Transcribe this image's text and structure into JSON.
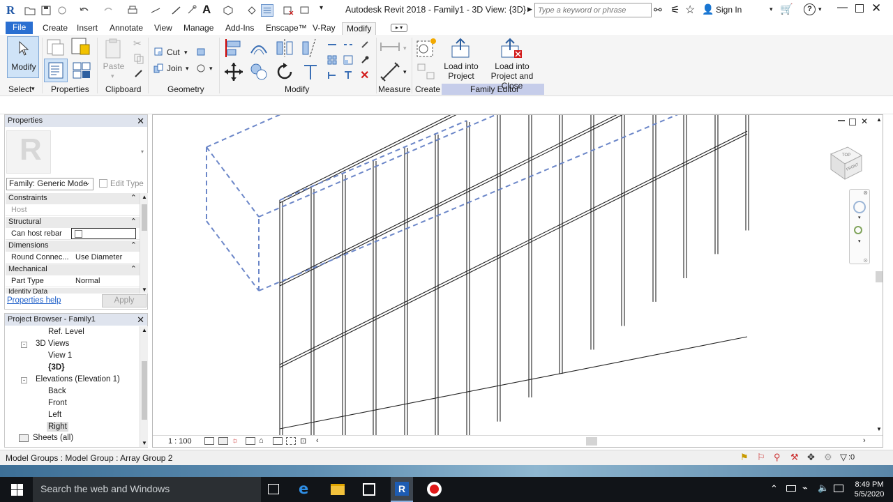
{
  "app": {
    "title": "Autodesk Revit 2018 -    Family1 - 3D View: {3D}",
    "search_placeholder": "Type a keyword or phrase",
    "sign_in": "Sign In"
  },
  "tabs": [
    "File",
    "Create",
    "Insert",
    "Annotate",
    "View",
    "Manage",
    "Add-Ins",
    "Enscape™",
    "V-Ray",
    "Modify"
  ],
  "active_tab": "Modify",
  "ribbon": {
    "modify_label": "Modify",
    "select_label": "Select",
    "properties_label": "Properties",
    "paste_label": "Paste",
    "clipboard_label": "Clipboard",
    "cut_label": "Cut",
    "join_label": "Join",
    "geometry_label": "Geometry",
    "modify_panel_label": "Modify",
    "measure_label": "Measure",
    "create_label": "Create",
    "load_into_project": "Load into\nProject",
    "load_into_project_close": "Load into\nProject and Close",
    "family_editor_label": "Family Editor"
  },
  "properties": {
    "header": "Properties",
    "type_selector": "Family: Generic Mode",
    "edit_type": "Edit Type",
    "sections": [
      {
        "name": "Constraints",
        "rows": [
          {
            "name": "Host",
            "value": ""
          }
        ]
      },
      {
        "name": "Structural",
        "rows": [
          {
            "name": "Can host rebar",
            "value": ""
          }
        ]
      },
      {
        "name": "Dimensions",
        "rows": [
          {
            "name": "Round Connec...",
            "value": "Use Diameter"
          }
        ]
      },
      {
        "name": "Mechanical",
        "rows": [
          {
            "name": "Part Type",
            "value": "Normal"
          }
        ]
      }
    ],
    "cut_section": "Identity Data",
    "help_link": "Properties help",
    "apply": "Apply"
  },
  "browser": {
    "header": "Project Browser - Family1",
    "items": [
      {
        "label": "Ref. Level",
        "level": 2
      },
      {
        "label": "3D Views",
        "level": 1,
        "toggle": "−"
      },
      {
        "label": "View 1",
        "level": 2
      },
      {
        "label": "{3D}",
        "level": 2,
        "bold": true
      },
      {
        "label": "Elevations (Elevation 1)",
        "level": 1,
        "toggle": "−"
      },
      {
        "label": "Back",
        "level": 2
      },
      {
        "label": "Front",
        "level": 2
      },
      {
        "label": "Left",
        "level": 2
      },
      {
        "label": "Right",
        "level": 2,
        "selected": true
      },
      {
        "label": "Sheets (all)",
        "level": 0
      }
    ]
  },
  "viewport": {
    "scale": "1 : 100",
    "viewcube_top": "TOP",
    "viewcube_front": "FRONT"
  },
  "status": {
    "text": "Model Groups : Model Group : Array Group 2",
    "filter_count": ":0"
  },
  "taskbar": {
    "search": "Search the web and Windows",
    "time": "8:49 PM",
    "date": "5/5/2020"
  },
  "colors": {
    "file_tab": "#2a6fd1",
    "family_editor_band": "#c6cdea",
    "selection_dash": "#6b86c8"
  }
}
